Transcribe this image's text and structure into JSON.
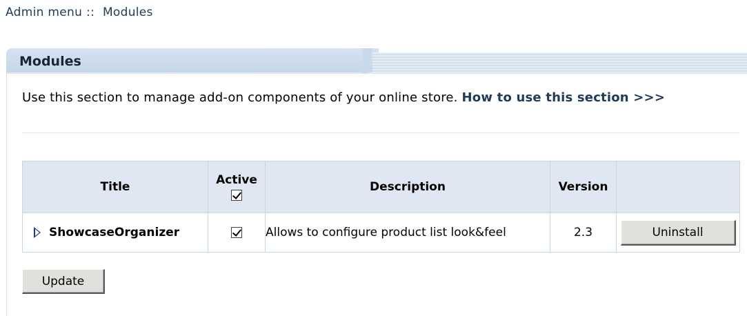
{
  "breadcrumb": {
    "root": "Admin menu",
    "separator": "::",
    "current": "Modules"
  },
  "panel": {
    "title": "Modules",
    "intro_text": "Use this section to manage add-on components of your online store.",
    "help_link": "How to use this section >>>"
  },
  "table": {
    "headers": {
      "title": "Title",
      "active": "Active",
      "description": "Description",
      "version": "Version"
    },
    "rows": [
      {
        "title": "ShowcaseOrganizer",
        "active": true,
        "description": "Allows to configure product list look&feel",
        "version": "2.3",
        "action_label": "Uninstall"
      }
    ]
  },
  "update_button_label": "Update"
}
